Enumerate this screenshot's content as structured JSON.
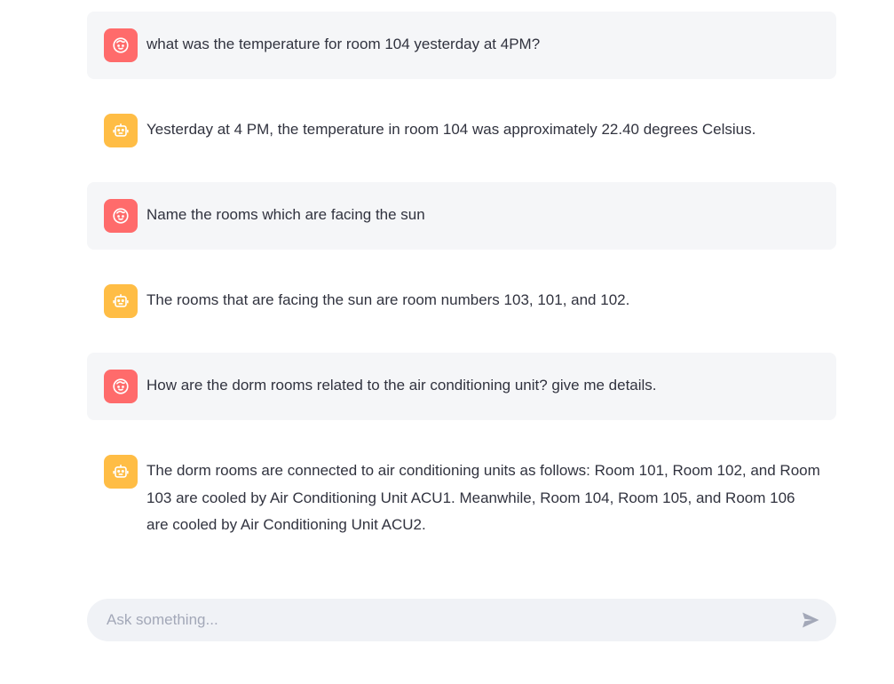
{
  "colors": {
    "user_avatar": "#ff6b6b",
    "bot_avatar": "#ffbd45",
    "user_bubble": "#f5f6f8",
    "input_bg": "#f0f2f6"
  },
  "messages": [
    {
      "role": "user",
      "avatar_icon": "user-face-icon",
      "text": "what was the temperature for room 104 yesterday at 4PM?"
    },
    {
      "role": "assistant",
      "avatar_icon": "robot-icon",
      "text": "Yesterday at 4 PM, the temperature in room 104 was approximately 22.40 degrees Celsius."
    },
    {
      "role": "user",
      "avatar_icon": "user-face-icon",
      "text": "Name the rooms which are facing the sun"
    },
    {
      "role": "assistant",
      "avatar_icon": "robot-icon",
      "text": "The rooms that are facing the sun are room numbers 103, 101, and 102."
    },
    {
      "role": "user",
      "avatar_icon": "user-face-icon",
      "text": "How are the dorm rooms related to the air conditioning unit? give me details."
    },
    {
      "role": "assistant",
      "avatar_icon": "robot-icon",
      "text": "The dorm rooms are connected to air conditioning units as follows: Room 101, Room 102, and Room 103 are cooled by Air Conditioning Unit ACU1. Meanwhile, Room 104, Room 105, and Room 106 are cooled by Air Conditioning Unit ACU2."
    }
  ],
  "chat_input": {
    "placeholder": "Ask something...",
    "value": "",
    "send_icon": "send-icon"
  }
}
